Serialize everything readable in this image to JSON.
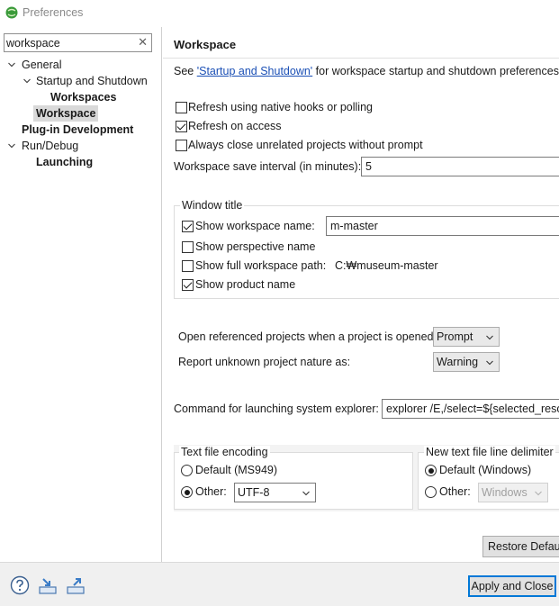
{
  "window": {
    "title": "Preferences",
    "icon": "eclipse-icon"
  },
  "filter": {
    "value": "workspace",
    "clear_glyph": "✕"
  },
  "tree": {
    "general": "General",
    "startup_shutdown": "Startup and Shutdown",
    "workspaces": "Workspaces",
    "workspace": "Workspace",
    "plugin_dev": "Plug-in Development",
    "run_debug": "Run/Debug",
    "launching": "Launching"
  },
  "page": {
    "title": "Workspace",
    "see_prefix": "See ",
    "see_link": "'Startup and Shutdown'",
    "see_suffix": " for workspace startup and shutdown preferences.",
    "refresh_native": {
      "label": "Refresh using native hooks or polling",
      "checked": false
    },
    "refresh_access": {
      "label": "Refresh on access",
      "checked": true
    },
    "always_close": {
      "label": "Always close unrelated projects without prompt",
      "checked": false
    },
    "save_interval": {
      "label": "Workspace save interval (in minutes):",
      "value": "5"
    }
  },
  "window_title_group": {
    "title": "Window title",
    "show_workspace_name": {
      "label": "Show workspace name:",
      "checked": true,
      "value": "m-master"
    },
    "show_perspective_name": {
      "label": "Show perspective name",
      "checked": false
    },
    "show_full_path": {
      "label": "Show full workspace path:",
      "checked": false,
      "value": "C:₩museum-master"
    },
    "show_product_name": {
      "label": "Show product name",
      "checked": true
    }
  },
  "projects": {
    "open_referenced": {
      "label": "Open referenced projects when a project is opened:",
      "value": "Prompt"
    },
    "unknown_nature": {
      "label": "Report unknown project nature as:",
      "value": "Warning"
    }
  },
  "explorer": {
    "label": "Command for launching system explorer:",
    "value": "explorer /E,/select=${selected_resource_loc}"
  },
  "encoding": {
    "title": "Text file encoding",
    "default_label": "Default (MS949)",
    "other_label": "Other:",
    "selected": "other",
    "other_value": "UTF-8"
  },
  "line_delimiter": {
    "title": "New text file line delimiter",
    "default_label": "Default (Windows)",
    "other_label": "Other:",
    "selected": "default",
    "other_value": "Windows"
  },
  "buttons": {
    "restore_defaults": "Restore Defaults",
    "apply_close": "Apply and Close"
  },
  "bottom_icons": [
    "help-icon",
    "import-icon",
    "export-icon"
  ],
  "colors": {
    "link": "#1a4fb5",
    "selection": "#d9d9d9",
    "default_button_border": "#0078d7"
  }
}
